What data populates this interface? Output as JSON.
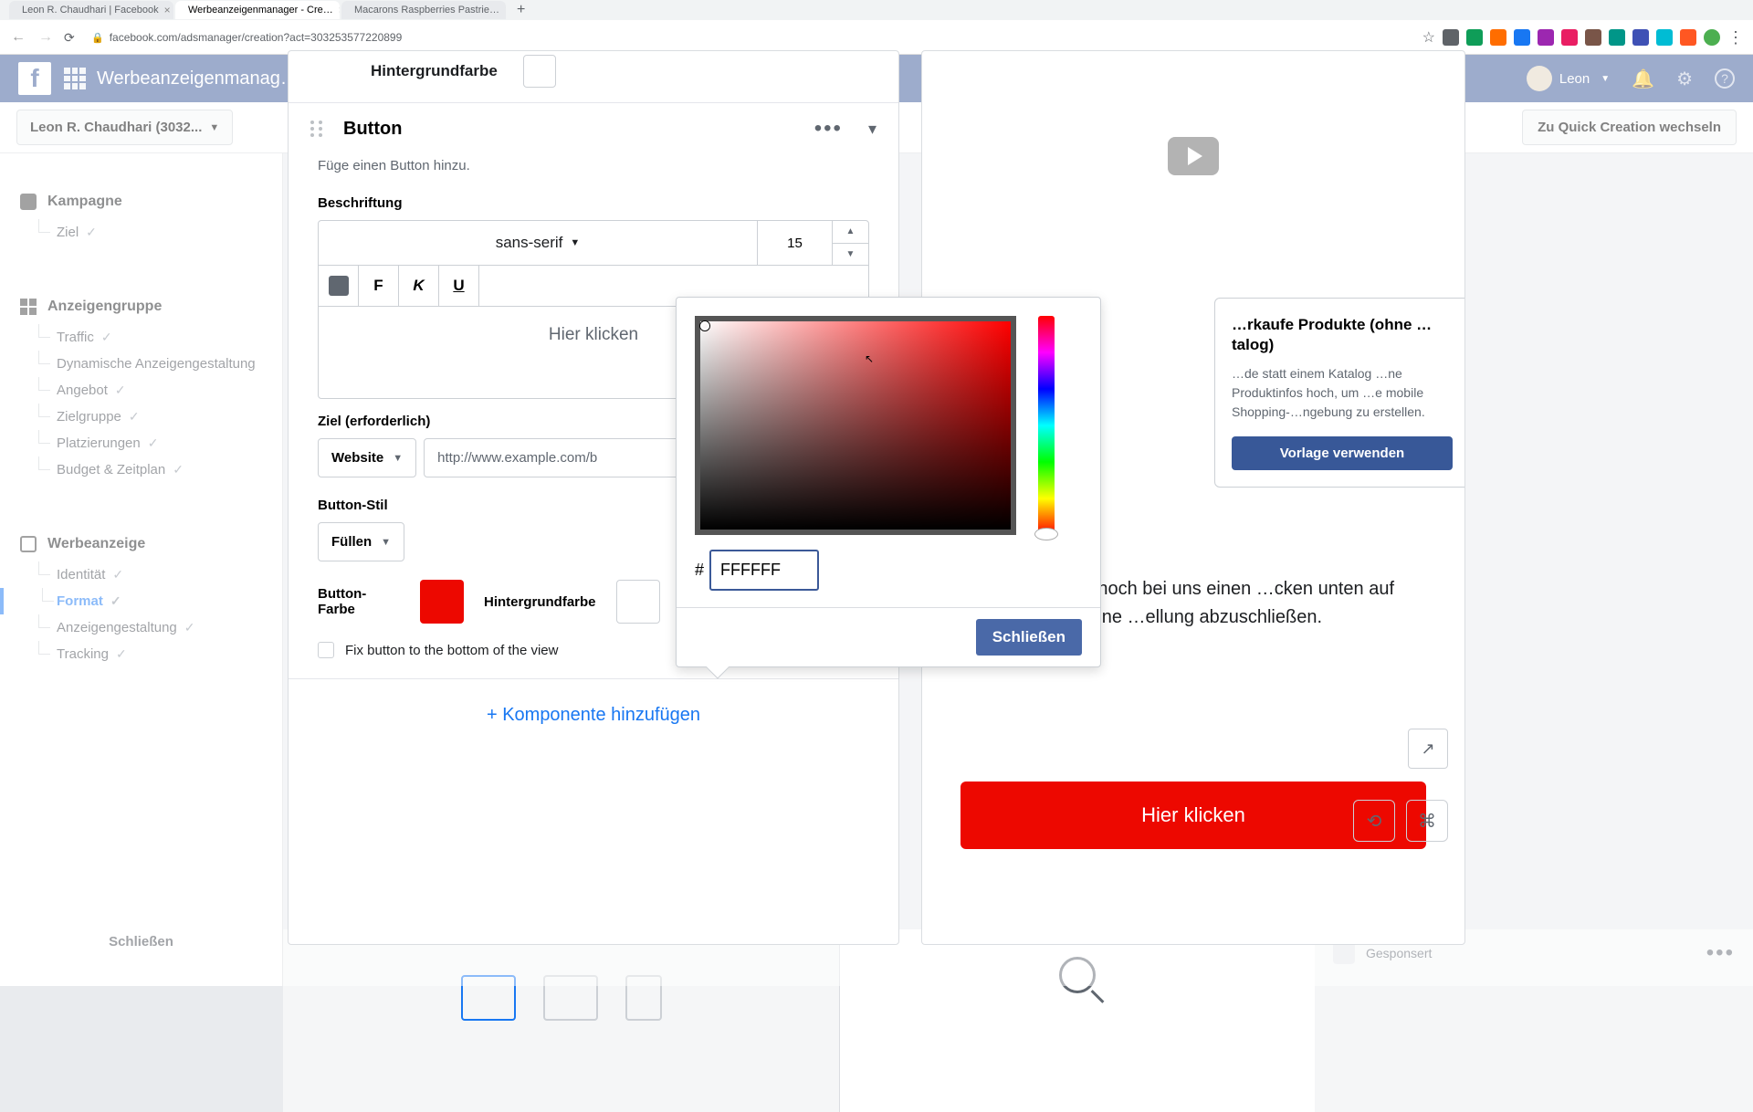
{
  "browser": {
    "tabs": [
      {
        "title": "Leon R. Chaudhari | Facebook",
        "active": false,
        "favicon": "#1877f2"
      },
      {
        "title": "Werbeanzeigenmanager - Cre…",
        "active": true,
        "favicon": "#1877f2"
      },
      {
        "title": "Macarons Raspberries Pastrie…",
        "active": false,
        "favicon": "#0f9d58"
      }
    ],
    "url": "facebook.com/adsmanager/creation?act=303253577220899"
  },
  "topnav": {
    "app_title": "Werbeanzeigenmanag…",
    "user_name": "Leon"
  },
  "secbar": {
    "account": "Leon R. Chaudhari (3032...",
    "quick_btn": "Zu Quick Creation wechseln"
  },
  "sidebar": {
    "campaign": {
      "title": "Kampagne",
      "items": [
        {
          "label": "Ziel",
          "checked": true
        }
      ]
    },
    "adset": {
      "title": "Anzeigengruppe",
      "items": [
        {
          "label": "Traffic",
          "checked": true
        },
        {
          "label": "Dynamische Anzeigengestaltung",
          "checked": false
        },
        {
          "label": "Angebot",
          "checked": true
        },
        {
          "label": "Zielgruppe",
          "checked": true
        },
        {
          "label": "Platzierungen",
          "checked": true
        },
        {
          "label": "Budget & Zeitplan",
          "checked": true
        }
      ]
    },
    "ad": {
      "title": "Werbeanzeige",
      "items": [
        {
          "label": "Identität",
          "checked": true
        },
        {
          "label": "Format",
          "checked": true,
          "active": true
        },
        {
          "label": "Anzeigengestaltung",
          "checked": true
        },
        {
          "label": "Tracking",
          "checked": true
        }
      ]
    },
    "close_btn": "Schließen"
  },
  "editor": {
    "bg_label": "Hintergrundfarbe",
    "button_section": {
      "title": "Button",
      "help": "Füge einen Button hinzu.",
      "label_field": "Beschriftung",
      "font": "sans-serif",
      "font_size": "15",
      "bold": "F",
      "italic": "K",
      "underline": "U",
      "text_value": "Hier klicken",
      "dest_label": "Ziel (erforderlich)",
      "dest_type": "Website",
      "dest_url": "http://www.example.com/b",
      "style_label": "Button-Stil",
      "style_value": "Füllen",
      "btn_color_label": "Button-Farbe",
      "btn_color_value": "#ed0800",
      "bg_color_label": "Hintergrundfarbe",
      "fix_label": "Fix button to the bottom of the view"
    },
    "add_component": "+ Komponente hinzufügen"
  },
  "preview": {
    "promo_title": "…rkaufe Produkte (ohne …talog)",
    "promo_text": "…de statt einem Katalog …ne Produktinfos hoch, um …e mobile Shopping-…ngebung zu erstellen.",
    "promo_btn": "Vorlage verwenden",
    "body_text": "…enn du heute noch bei uns einen …cken unten auf den Link, um deine …ellung abzuschließen.",
    "cta_text": "Hier klicken"
  },
  "picker": {
    "hex_value": "FFFFFF",
    "close_btn": "Schließen"
  },
  "bg_bottom": {
    "sponsored": "Gesponsert"
  }
}
